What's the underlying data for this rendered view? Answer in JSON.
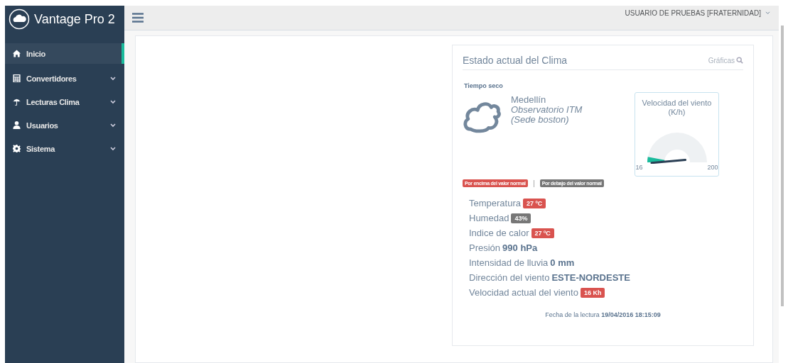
{
  "brand": {
    "title": "Vantage Pro 2"
  },
  "sidebar": {
    "items": [
      {
        "label": "Inicio",
        "selected": true,
        "expandable": false
      },
      {
        "label": "Convertidores",
        "selected": false,
        "expandable": true
      },
      {
        "label": "Lecturas Clima",
        "selected": false,
        "expandable": true
      },
      {
        "label": "Usuarios",
        "selected": false,
        "expandable": true
      },
      {
        "label": "Sistema",
        "selected": false,
        "expandable": true
      }
    ]
  },
  "topbar": {
    "user": "USUARIO DE PRUEBAS [FRATERNIDAD]"
  },
  "card": {
    "title": "Estado actual del Clima",
    "link": "Gráficas",
    "condition": "Tiempo seco",
    "city": "Medellín",
    "station": [
      "Observatorio ITM",
      "(Sede boston)"
    ],
    "gauge": {
      "title": "Velocidad del viento (K/h)",
      "min": "16",
      "max": "200",
      "level": 0.06
    },
    "legend": [
      {
        "label": "Por encima del valor normal",
        "color": "#d9534f"
      },
      {
        "label": "Por debajo del valor normal",
        "color": "#777777"
      }
    ],
    "readings": [
      {
        "label": "Temperatura",
        "value": "27 ºC",
        "kind": "badge",
        "color": "#d9534f"
      },
      {
        "label": "Humedad",
        "value": "43%",
        "kind": "badge",
        "color": "#777777"
      },
      {
        "label": "Indice de calor",
        "value": "27 ºC",
        "kind": "badge",
        "color": "#d9534f"
      },
      {
        "label": "Presión",
        "value": "990 hPa",
        "kind": "bold"
      },
      {
        "label": "Intensidad de lluvia",
        "value": "0 mm",
        "kind": "bold"
      },
      {
        "label": "Dirección del viento",
        "value": "ESTE-NORDESTE",
        "kind": "bold"
      },
      {
        "label": "Velocidad actual del viento",
        "value": "16 Kh",
        "kind": "badge",
        "color": "#d9534f"
      }
    ],
    "footer": {
      "label": "Fecha de la lectura",
      "value": "19/04/2016 18:15:09"
    }
  }
}
